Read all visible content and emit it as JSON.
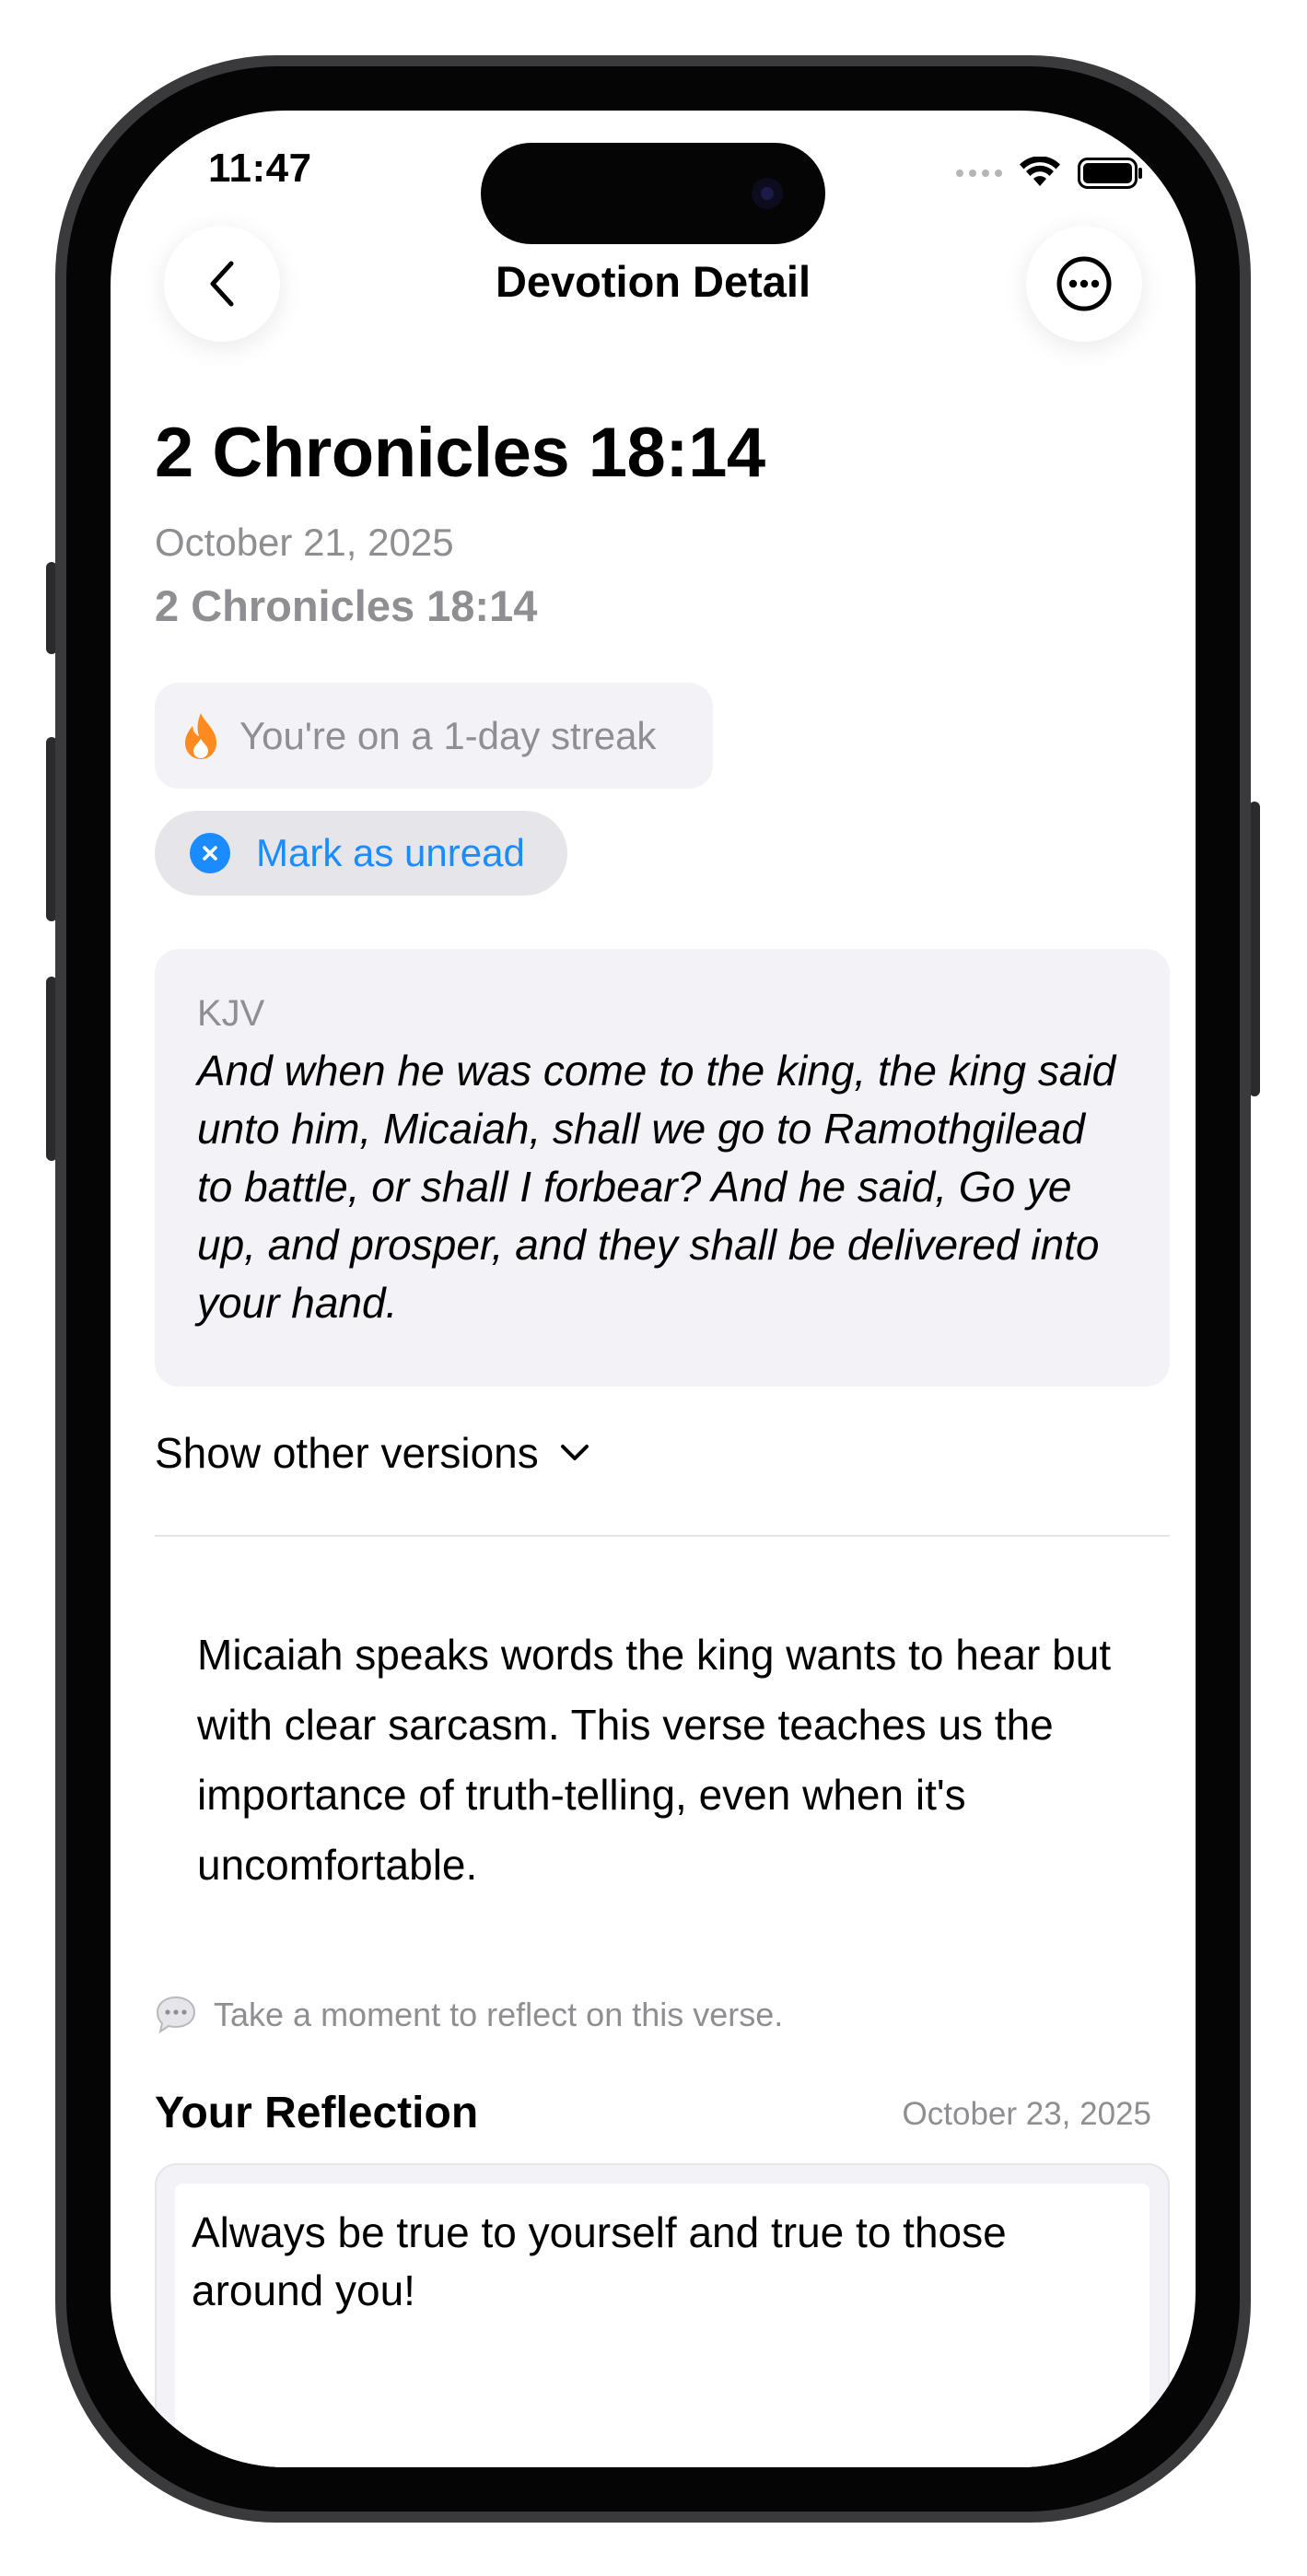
{
  "status_bar": {
    "time": "11:47"
  },
  "nav": {
    "title": "Devotion Detail",
    "back_icon": "chevron-left-icon",
    "more_icon": "ellipsis-circle-icon"
  },
  "devotion": {
    "title": "2 Chronicles 18:14",
    "date": "October 21, 2025",
    "reference": "2 Chronicles 18:14",
    "streak_text": "You're on a 1-day streak",
    "mark_unread_label": "Mark as unread",
    "verse_version": "KJV",
    "verse_text": "And when he was come to the king, the king said unto him, Micaiah, shall we go to Ramothgilead to battle, or shall I forbear? And he said, Go ye up, and prosper, and they shall be delivered into your hand.",
    "show_versions_label": "Show other versions",
    "body": "Micaiah speaks words the king wants to hear but with clear sarcasm. This verse teaches us the importance of truth-telling, even when it's uncomfortable.",
    "reflect_prompt": "Take a moment to reflect on this verse."
  },
  "reflection": {
    "heading": "Your Reflection",
    "date": "October 23, 2025",
    "text": "Always be true to yourself and true to those around you!"
  },
  "colors": {
    "accent": "#1a8cff",
    "flame": "#ff8a1f",
    "card": "#f2f2f7",
    "secondary_text": "#8e8e93"
  }
}
